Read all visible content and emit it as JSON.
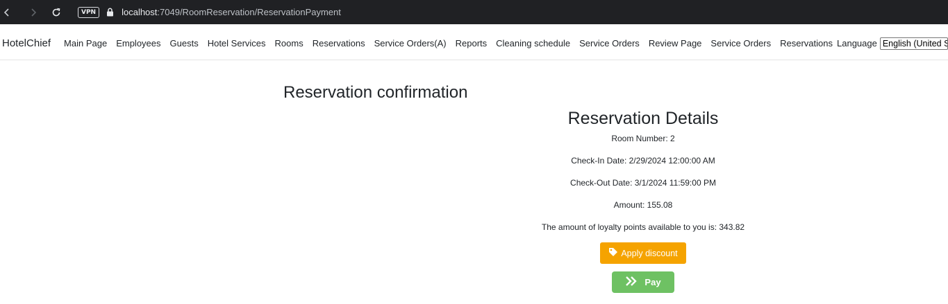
{
  "browser": {
    "vpn_label": "VPN",
    "url_host": "localhost",
    "url_rest": ":7049/RoomReservation/ReservationPayment"
  },
  "navbar": {
    "brand": "HotelChief",
    "links": [
      "Main Page",
      "Employees",
      "Guests",
      "Hotel Services",
      "Rooms",
      "Reservations",
      "Service Orders(A)",
      "Reports",
      "Cleaning schedule",
      "Service Orders",
      "Review Page",
      "Service Orders",
      "Reservations"
    ],
    "language_label": "Language",
    "language_selected": "English (United States)"
  },
  "main": {
    "title": "Reservation confirmation",
    "details_heading": "Reservation Details",
    "room_number": "Room Number: 2",
    "check_in": "Check-In Date: 2/29/2024 12:00:00 AM",
    "check_out": "Check-Out Date: 3/1/2024 11:59:00 PM",
    "amount": "Amount: 155.08",
    "loyalty": "The amount of loyalty points available to you is: 343.82",
    "discount_label": "Apply discount",
    "pay_label": "Pay"
  },
  "colors": {
    "discount_button": "#f5a300",
    "pay_button": "#6ec163",
    "browser_bar": "#202124"
  }
}
